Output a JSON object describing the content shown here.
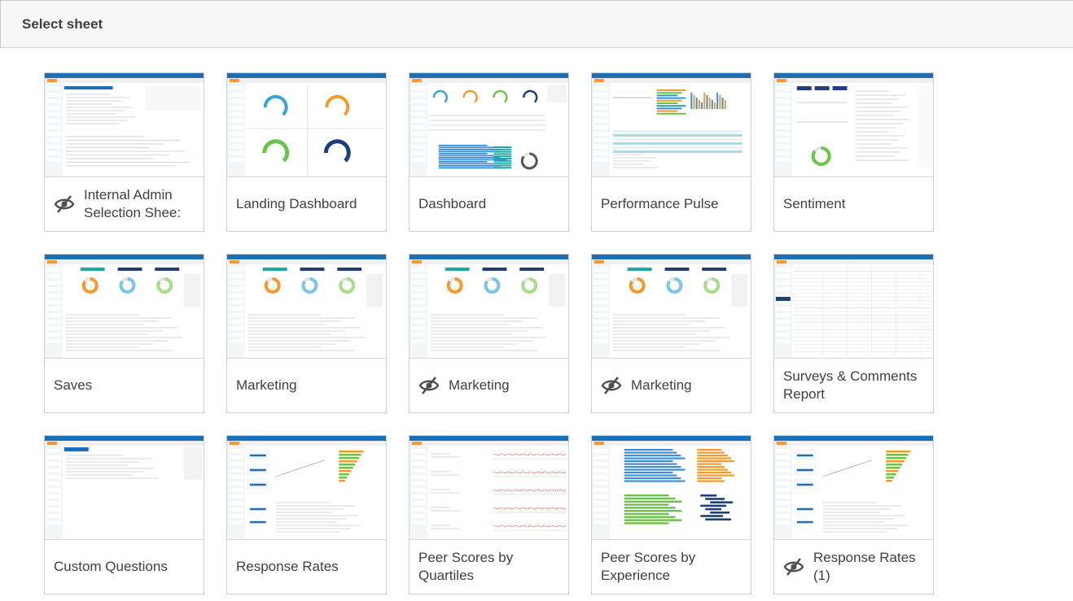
{
  "header": {
    "title": "Select sheet"
  },
  "sheets": [
    {
      "title": "Internal Admin Selection Shee:",
      "hidden": true,
      "thumb": "admin-table"
    },
    {
      "title": "Landing Dashboard",
      "hidden": false,
      "thumb": "gauges"
    },
    {
      "title": "Dashboard",
      "hidden": false,
      "thumb": "dashboard"
    },
    {
      "title": "Performance Pulse",
      "hidden": false,
      "thumb": "pulse"
    },
    {
      "title": "Sentiment",
      "hidden": false,
      "thumb": "sentiment"
    },
    {
      "title": "Saves",
      "hidden": false,
      "thumb": "rings-table"
    },
    {
      "title": "Marketing",
      "hidden": false,
      "thumb": "rings-table"
    },
    {
      "title": "Marketing",
      "hidden": true,
      "thumb": "rings-table"
    },
    {
      "title": "Marketing",
      "hidden": true,
      "thumb": "rings-table"
    },
    {
      "title": "Surveys & Comments Report",
      "hidden": false,
      "thumb": "report-table"
    },
    {
      "title": "Custom Questions",
      "hidden": false,
      "thumb": "questions"
    },
    {
      "title": "Response Rates",
      "hidden": false,
      "thumb": "kpi-bars"
    },
    {
      "title": "Peer Scores by Quartiles",
      "hidden": false,
      "thumb": "lines"
    },
    {
      "title": "Peer Scores by Experience",
      "hidden": false,
      "thumb": "hbars"
    },
    {
      "title": "Response Rates (1)",
      "hidden": true,
      "thumb": "kpi-bars"
    }
  ],
  "colors": {
    "accent_blue": "#1f6fb5",
    "orange": "#f39a2b",
    "light_blue": "#7bc4ea",
    "green": "#6cc24a",
    "navy": "#1f3f7a",
    "teal": "#1ea7a4"
  },
  "icons": {
    "hidden": "eye-slash-icon"
  }
}
